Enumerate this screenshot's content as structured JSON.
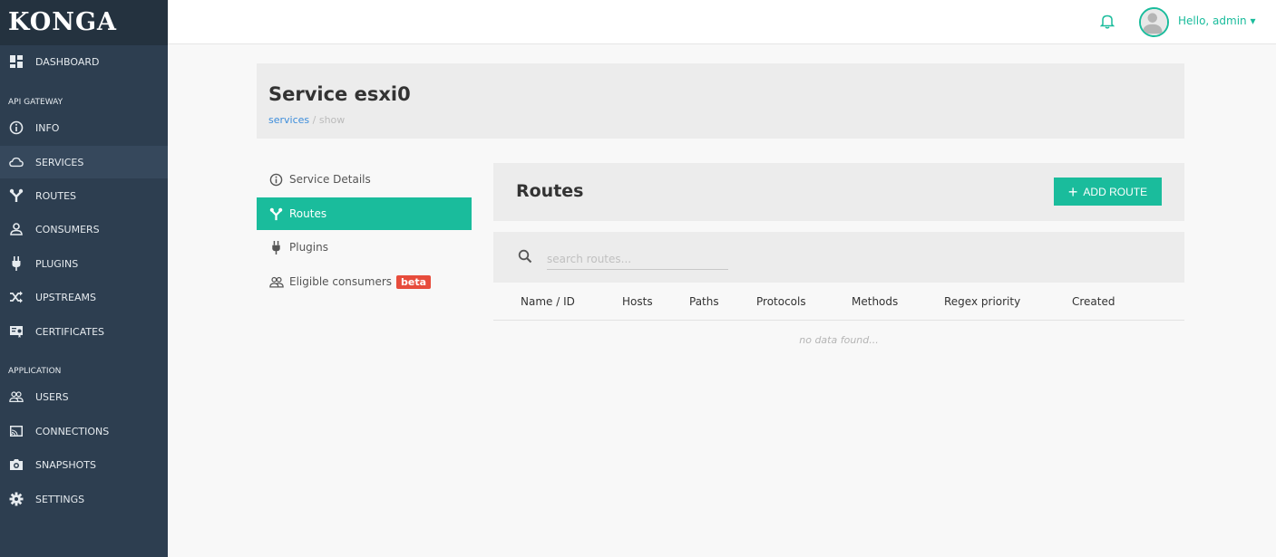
{
  "app": {
    "logo": "KONGA"
  },
  "sidebar": {
    "items": [
      {
        "label": "DASHBOARD",
        "icon": "dashboard-icon"
      },
      {
        "label": "INFO",
        "icon": "info-icon"
      },
      {
        "label": "SERVICES",
        "icon": "cloud-icon",
        "active": true
      },
      {
        "label": "ROUTES",
        "icon": "routes-icon"
      },
      {
        "label": "CONSUMERS",
        "icon": "user-icon"
      },
      {
        "label": "PLUGINS",
        "icon": "plug-icon"
      },
      {
        "label": "UPSTREAMS",
        "icon": "shuffle-icon"
      },
      {
        "label": "CERTIFICATES",
        "icon": "certificate-icon"
      },
      {
        "label": "USERS",
        "icon": "users-icon"
      },
      {
        "label": "CONNECTIONS",
        "icon": "cast-icon"
      },
      {
        "label": "SNAPSHOTS",
        "icon": "camera-icon"
      },
      {
        "label": "SETTINGS",
        "icon": "gear-icon"
      }
    ],
    "sections": {
      "api_gateway": "API GATEWAY",
      "application": "APPLICATION"
    }
  },
  "topbar": {
    "greeting": "Hello, admin",
    "caret": "▾"
  },
  "header": {
    "title": "Service esxi0",
    "breadcrumb": {
      "link": "services",
      "sep": "/",
      "current": "show"
    }
  },
  "tabs": [
    {
      "label": "Service Details",
      "icon": "info-icon"
    },
    {
      "label": "Routes",
      "icon": "routes-icon",
      "active": true
    },
    {
      "label": "Plugins",
      "icon": "plug-icon"
    },
    {
      "label": "Eligible consumers",
      "icon": "users-icon",
      "badge": "beta"
    }
  ],
  "routes": {
    "title": "Routes",
    "add_button": "ADD ROUTE",
    "search_placeholder": "search routes...",
    "columns": [
      "Name / ID",
      "Hosts",
      "Paths",
      "Protocols",
      "Methods",
      "Regex priority",
      "Created"
    ],
    "empty_text": "no data found..."
  },
  "colors": {
    "accent": "#1abc9c",
    "sidebar": "#2d3e50",
    "badge": "#e74c3c",
    "link": "#3c8ddb"
  }
}
